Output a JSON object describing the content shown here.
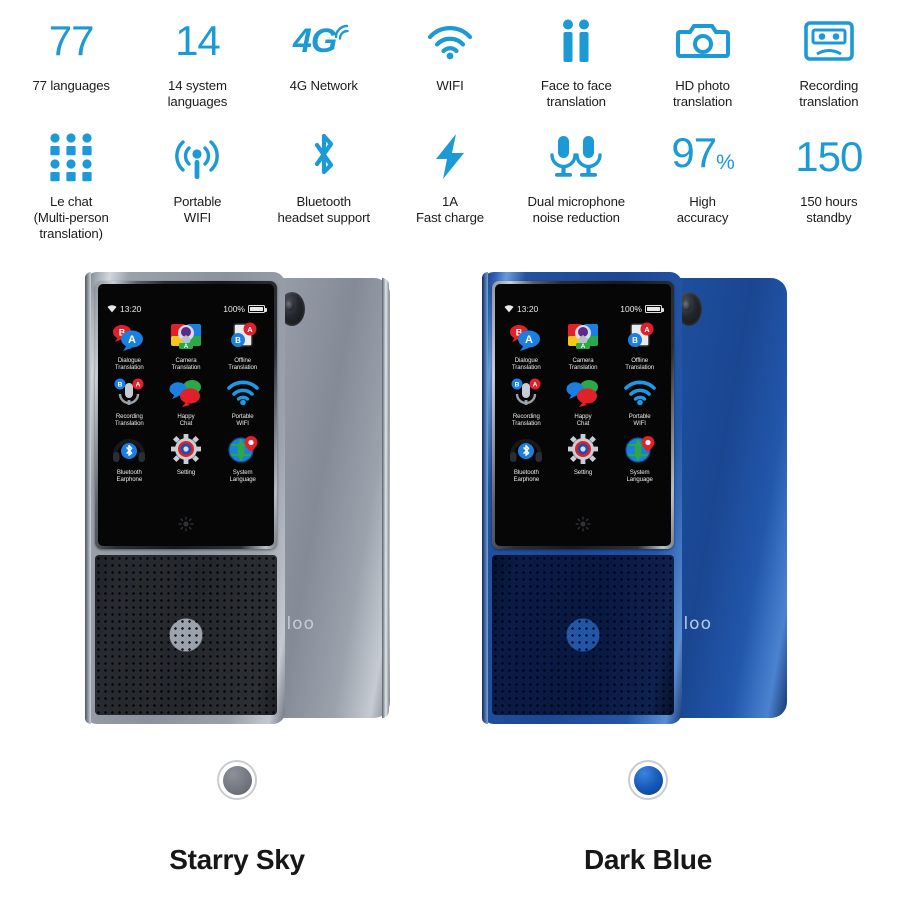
{
  "theme": {
    "brand_blue": "#1c9ad6",
    "text_dark": "#1c1c1c",
    "background": "#ffffff"
  },
  "features": {
    "row1": [
      {
        "icon": "number-77-icon",
        "value": "77",
        "label_lines": [
          "77 languages"
        ],
        "kind": "number"
      },
      {
        "icon": "number-14-icon",
        "value": "14",
        "label_lines": [
          "14 system",
          "languages"
        ],
        "kind": "number"
      },
      {
        "icon": "4g-network-icon",
        "value": "4G",
        "label_lines": [
          "4G Network"
        ],
        "kind": "glyph"
      },
      {
        "icon": "wifi-icon",
        "value": "",
        "label_lines": [
          "WIFI"
        ],
        "kind": "svg"
      },
      {
        "icon": "two-persons-icon",
        "value": "",
        "label_lines": [
          "Face to face",
          "translation"
        ],
        "kind": "svg"
      },
      {
        "icon": "camera-icon",
        "value": "",
        "label_lines": [
          "HD photo",
          "translation"
        ],
        "kind": "svg"
      },
      {
        "icon": "cassette-tape-icon",
        "value": "",
        "label_lines": [
          "Recording",
          "translation"
        ],
        "kind": "svg"
      }
    ],
    "row2": [
      {
        "icon": "dot-grid-icon",
        "value": "",
        "label_lines": [
          "Le chat",
          "(Multi-person",
          "translation)"
        ],
        "kind": "svg"
      },
      {
        "icon": "hotspot-antenna-icon",
        "value": "",
        "label_lines": [
          "Portable",
          "WIFI"
        ],
        "kind": "svg"
      },
      {
        "icon": "bluetooth-icon",
        "value": "",
        "label_lines": [
          "Bluetooth",
          "headset support"
        ],
        "kind": "svg"
      },
      {
        "icon": "lightning-bolt-icon",
        "value": "",
        "label_lines": [
          "1A",
          "Fast charge"
        ],
        "kind": "svg"
      },
      {
        "icon": "dual-microphone-icon",
        "value": "",
        "label_lines": [
          "Dual microphone",
          "noise reduction"
        ],
        "kind": "svg"
      },
      {
        "icon": "number-97-percent-icon",
        "value": "97",
        "suffix": "%",
        "label_lines": [
          "High",
          "accuracy"
        ],
        "kind": "number"
      },
      {
        "icon": "number-150-icon",
        "value": "150",
        "label_lines": [
          "150 hours",
          "standby"
        ],
        "kind": "number"
      }
    ]
  },
  "device_screen": {
    "status_bar": {
      "wifi_icon": "wifi-status-icon",
      "time": "13:20",
      "battery_percent": "100%",
      "battery_icon": "battery-full-icon"
    },
    "apps": [
      {
        "icon": "dialogue-translation-icon",
        "label_lines": [
          "Dialogue",
          "Translation"
        ]
      },
      {
        "icon": "camera-translation-icon",
        "label_lines": [
          "Camera",
          "Translation"
        ]
      },
      {
        "icon": "offline-translation-icon",
        "label_lines": [
          "Offline",
          "Translation"
        ]
      },
      {
        "icon": "recording-translation-icon",
        "label_lines": [
          "Recording",
          "Translation"
        ]
      },
      {
        "icon": "happy-chat-icon",
        "label_lines": [
          "Happy",
          "Chat"
        ]
      },
      {
        "icon": "portable-wifi-icon",
        "label_lines": [
          "Portable",
          "WIFI"
        ]
      },
      {
        "icon": "bluetooth-earphone-icon",
        "label_lines": [
          "Bluetooth",
          "Earphone"
        ]
      },
      {
        "icon": "setting-icon",
        "label_lines": [
          "Setting"
        ]
      },
      {
        "icon": "system-language-icon",
        "label_lines": [
          "System",
          "Language"
        ]
      }
    ],
    "home_glyph": "brightness-sunburst-icon"
  },
  "devices": [
    {
      "name": "starry-sky-device",
      "brand_logo": "eloo",
      "body_color": "#8b939e",
      "swatch_color": "#72757f"
    },
    {
      "name": "dark-blue-device",
      "brand_logo": "eloo",
      "body_color": "#1c4fa1",
      "swatch_color": "#1457b5"
    }
  ],
  "color_options": [
    {
      "name": "Starry Sky",
      "swatch": "#72757f"
    },
    {
      "name": "Dark Blue",
      "swatch": "#1457b5"
    }
  ]
}
